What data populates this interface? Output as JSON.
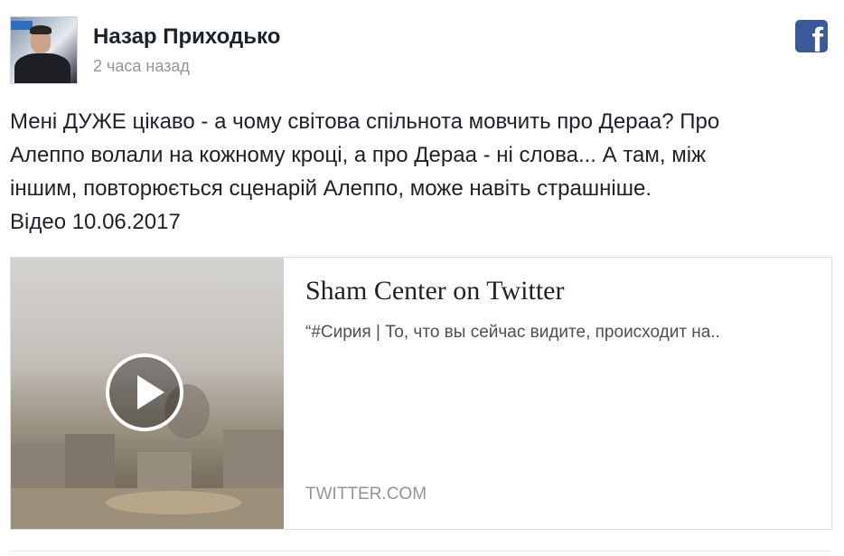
{
  "post": {
    "author": "Назар Приходько",
    "timestamp": "2 часа назад",
    "text_lines": [
      "Мені ДУЖЕ цікаво - а чому світова спільнота мовчить про Дераа? Про",
      "Алеппо волали на кожному кроці, а про Дераа - ні слова... А там, між",
      "іншим, повторюється сценарій Алеппо, може навіть страшніше.",
      "Відео 10.06.2017"
    ]
  },
  "link_card": {
    "title": "Sham Center on Twitter",
    "description": "“#Сирия | То, что вы сейчас видите, происходит на..",
    "domain": "TWITTER.COM"
  },
  "icons": {
    "facebook": "facebook-logo-icon",
    "play": "play-icon"
  },
  "colors": {
    "facebook_blue": "#3b5998",
    "text_primary": "#1d2129",
    "text_secondary": "#90949c"
  }
}
